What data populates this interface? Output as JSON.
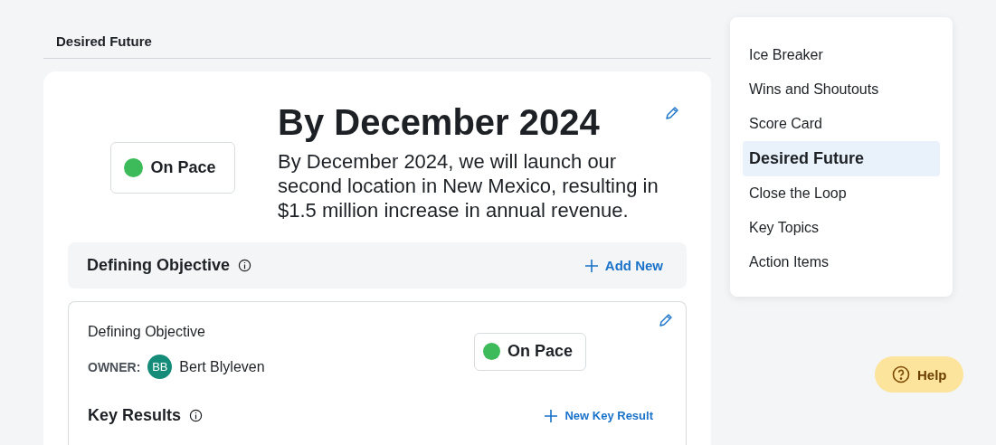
{
  "page_title": "Desired Future",
  "goal": {
    "status": {
      "label": "On Pace",
      "color": "#3dbb5a"
    },
    "title": "By December 2024",
    "description": "By December 2024, we will launch our second location in New Mexico, resulting in $1.5 million increase in annual revenue."
  },
  "section": {
    "title": "Defining Objective",
    "action": "Add New"
  },
  "objective": {
    "title": "Defining Objective",
    "owner_label": "OWNER:",
    "owner_initials": "BB",
    "owner_name": "Bert Blyleven",
    "status": {
      "label": "On Pace",
      "color": "#3dbb5a"
    },
    "key_results_title": "Key Results",
    "key_results_action": "New Key Result"
  },
  "nav": {
    "items": [
      {
        "label": "Ice Breaker",
        "selected": false
      },
      {
        "label": "Wins and Shoutouts",
        "selected": false
      },
      {
        "label": "Score Card",
        "selected": false
      },
      {
        "label": "Desired Future",
        "selected": true
      },
      {
        "label": "Close the Loop",
        "selected": false
      },
      {
        "label": "Key Topics",
        "selected": false
      },
      {
        "label": "Action Items",
        "selected": false
      }
    ]
  },
  "help": {
    "label": "Help"
  }
}
